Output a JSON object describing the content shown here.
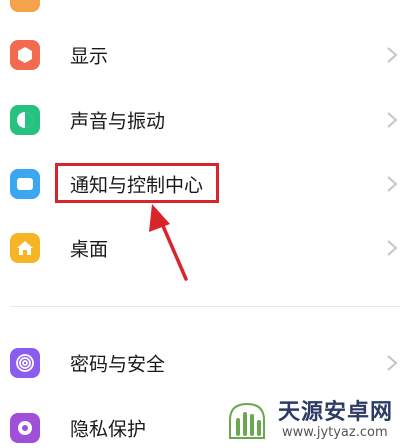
{
  "settings": {
    "items": [
      {
        "label": "显示",
        "icon": "display-icon",
        "color": "#f26b4f"
      },
      {
        "label": "声音与振动",
        "icon": "sound-icon",
        "color": "#26c281"
      },
      {
        "label": "通知与控制中心",
        "icon": "notification-icon",
        "color": "#3aa7f0"
      },
      {
        "label": "桌面",
        "icon": "home-icon",
        "color": "#f6b623"
      },
      {
        "label": "密码与安全",
        "icon": "fingerprint-icon",
        "color": "#8a5cf0"
      },
      {
        "label": "隐私保护",
        "icon": "privacy-icon",
        "color": "#a04fd8"
      }
    ]
  },
  "annotation": {
    "highlight_color": "#d9242b"
  },
  "watermark": {
    "title": "天源安卓网",
    "url": "www.jytyaz.com"
  }
}
